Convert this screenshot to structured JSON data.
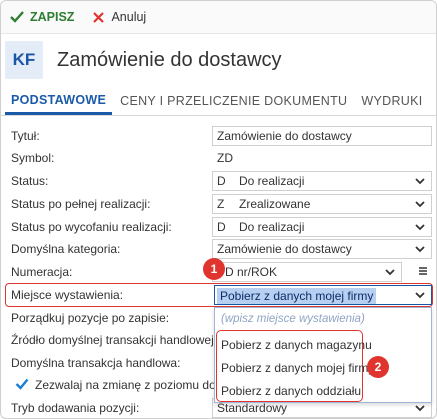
{
  "toolbar": {
    "save_label": "ZAPISZ",
    "cancel_label": "Anuluj"
  },
  "header": {
    "badge": "KF",
    "title": "Zamówienie do dostawcy"
  },
  "tabs": [
    {
      "label": "PODSTAWOWE",
      "active": true
    },
    {
      "label": "CENY I PRZELICZENIE DOKUMENTU",
      "active": false
    },
    {
      "label": "WYDRUKI",
      "active": false
    }
  ],
  "form": {
    "tytul": {
      "label": "Tytuł:",
      "value": "Zamówienie do dostawcy"
    },
    "symbol": {
      "label": "Symbol:",
      "value": "ZD"
    },
    "status": {
      "label": "Status:",
      "code": "D",
      "value": "Do realizacji"
    },
    "status_pelna": {
      "label": "Status po pełnej realizacji:",
      "code": "Z",
      "value": "Zrealizowane"
    },
    "status_wycofanie": {
      "label": "Status po wycofaniu realizacji:",
      "code": "D",
      "value": "Do realizacji"
    },
    "kategoria": {
      "label": "Domyślna kategoria:",
      "value": "Zamówienie do dostawcy"
    },
    "numeracja": {
      "label": "Numeracja:",
      "value": "D nr/ROK"
    },
    "miejsce": {
      "label": "Miejsce wystawienia:",
      "value": "Pobierz z danych mojej firmy"
    },
    "porzadkuj": {
      "label": "Porządkuj pozycje po zapisie:"
    },
    "zrodlo": {
      "label": "Źródło domyślnej transakcji handlowej:"
    },
    "transakcja": {
      "label": "Domyślna transakcja handlowa:"
    },
    "zezwalaj": {
      "label": "Zezwalaj na zmianę z poziomu dokum",
      "checked": true
    },
    "tryb": {
      "label": "Tryb dodawania pozycji:",
      "value": "Standardowy"
    }
  },
  "dropdown": {
    "placeholder": "(wpisz miejsce wystawienia)",
    "options": [
      "Pobierz z danych magazynu",
      "Pobierz z danych mojej firmy",
      "Pobierz z danych oddziału"
    ]
  },
  "markers": [
    "1",
    "2"
  ],
  "colors": {
    "accent": "#1a56a6",
    "save": "#2e7d32",
    "cancel": "#e0352f",
    "highlight": "#e0352f"
  }
}
